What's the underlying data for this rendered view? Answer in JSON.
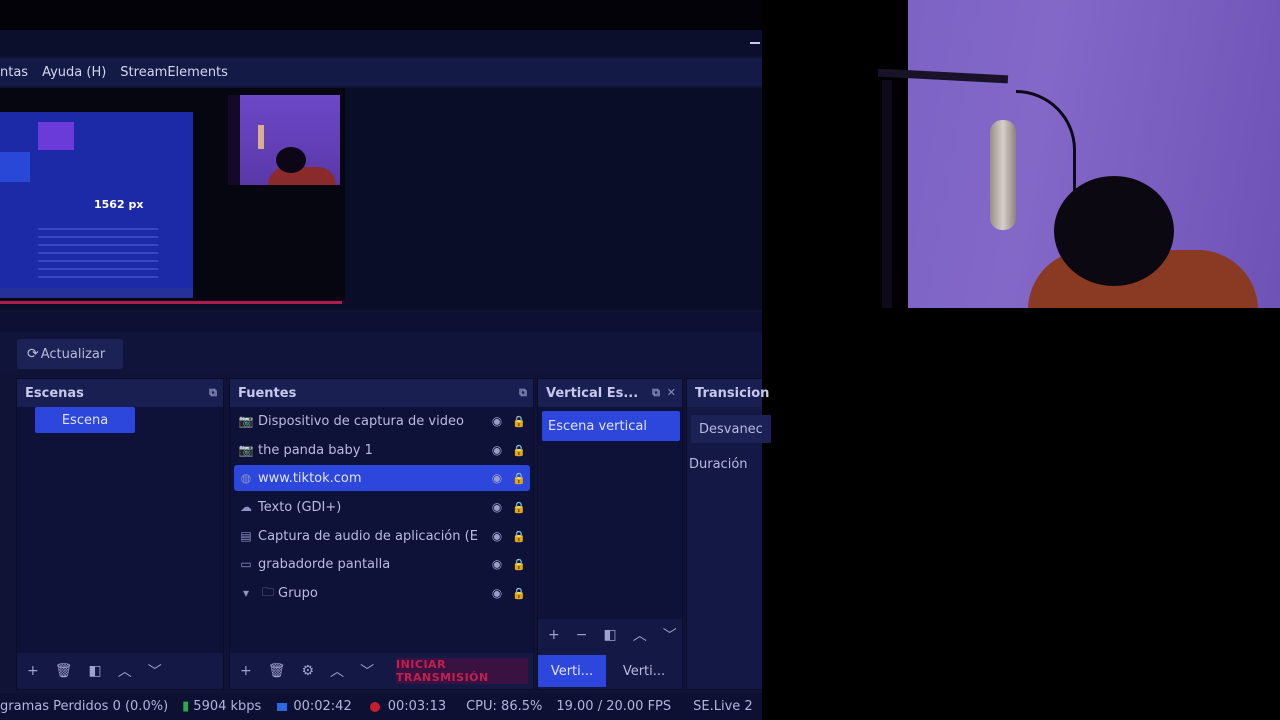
{
  "menubar": {
    "items": [
      "ntas",
      "Ayuda (H)",
      "StreamElements"
    ]
  },
  "preview": {
    "measure_label": "1562 px"
  },
  "toolbar": {
    "refresh_label": "Actualizar",
    "refresh_icon": "refresh-icon"
  },
  "scenes": {
    "title": "Escenas",
    "items": [
      "Escena"
    ]
  },
  "sources": {
    "title": "Fuentes",
    "items": [
      {
        "icon": "camera-icon",
        "name": "Dispositivo de captura de video"
      },
      {
        "icon": "camera-icon",
        "name": "the panda baby 1"
      },
      {
        "icon": "globe-icon",
        "name": "www.tiktok.com"
      },
      {
        "icon": "text-icon",
        "name": "Texto (GDI+)"
      },
      {
        "icon": "audio-capture-icon",
        "name": "Captura de audio de aplicación (E"
      },
      {
        "icon": "monitor-icon",
        "name": "grabadorde pantalla"
      },
      {
        "icon": "folder-icon",
        "name": "Grupo"
      }
    ],
    "stream_button": "INICIAR TRANSMISIÓN"
  },
  "vertical": {
    "title": "Vertical Es...",
    "items": [
      "Escena vertical"
    ],
    "tab1": "Verti...",
    "tab2": "Verti..."
  },
  "transitions": {
    "title": "Transicion",
    "selected": "Desvanec",
    "duration_label": "Duración"
  },
  "status": {
    "dropped": "gramas Perdidos 0 (0.0%)",
    "bitrate": "5904 kbps",
    "stream_time": "00:02:42",
    "rec_time": "00:03:13",
    "cpu": "CPU: 86.5%",
    "fps": "19.00 / 20.00 FPS",
    "se_live": "SE.Live 2"
  },
  "colors": {
    "accent": "#2d46dc",
    "background": "#101336",
    "record": "#c81e2c",
    "network_ok": "#2fa84a"
  }
}
